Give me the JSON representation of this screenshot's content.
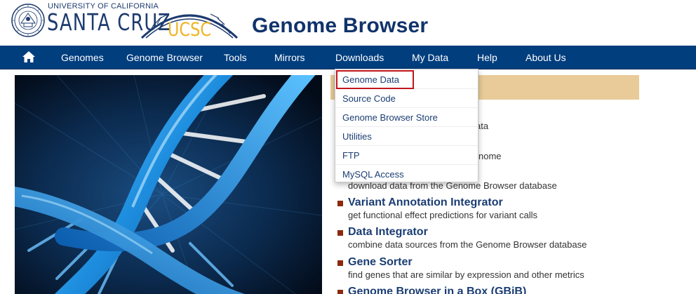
{
  "header": {
    "university_line": "UNIVERSITY OF CALIFORNIA",
    "campus": "SANTA CRUZ",
    "ucsc_wordmark": "UCSC",
    "title": "Genome Browser"
  },
  "nav": {
    "home_icon": "home-icon",
    "items": [
      "Genomes",
      "Genome Browser",
      "Tools",
      "Mirrors",
      "Downloads",
      "My Data",
      "Help",
      "About Us"
    ]
  },
  "dropdown": {
    "items": [
      "Genome Data",
      "Source Code",
      "Genome Browser Store",
      "Utilities",
      "FTP",
      "MySQL Access"
    ],
    "highlighted": "Genome Data"
  },
  "content": {
    "partial_lines": [
      "ata",
      "nome",
      "download data from the Genome Browser database"
    ],
    "tools": [
      {
        "title": "Variant Annotation Integrator",
        "desc": "get functional effect predictions for variant calls"
      },
      {
        "title": "Data Integrator",
        "desc": "combine data sources from the Genome Browser database"
      },
      {
        "title": "Gene Sorter",
        "desc": "find genes that are similar by expression and other metrics"
      },
      {
        "title": "Genome Browser in a Box (GBiB)",
        "desc": ""
      }
    ]
  },
  "colors": {
    "nav_bg": "#003e7e",
    "title_blue": "#10336b",
    "tan_bar": "#e8cb98",
    "bullet": "#8b2a0e",
    "highlight_border": "#c0161c"
  }
}
